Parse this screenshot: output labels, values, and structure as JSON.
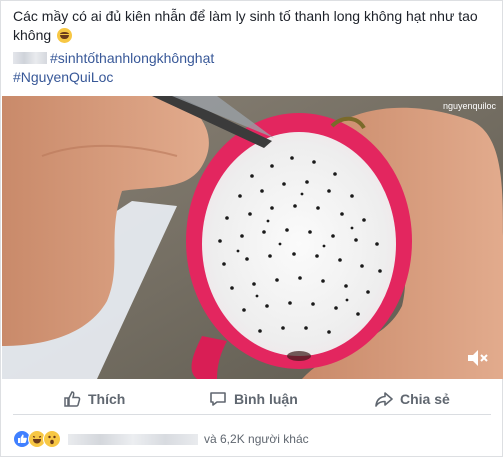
{
  "post": {
    "caption": "Các mầy có ai đủ kiên nhẫn để làm ly sinh tố thanh long không hạt như tao không",
    "hashtag1": "#sinhtốthanhlongkhônghạt",
    "hashtag2": "#NguyenQuiLoc"
  },
  "video": {
    "watermark": "nguyenquiloc"
  },
  "actions": {
    "like_label": "Thích",
    "comment_label": "Bình luận",
    "share_label": "Chia sẻ"
  },
  "reactions": {
    "others_text": "và 6,2K người khác"
  },
  "colors": {
    "link": "#385898",
    "action_text": "#606770",
    "like_blue": "#4080ff",
    "dragonfruit_skin": "#e0245e"
  }
}
